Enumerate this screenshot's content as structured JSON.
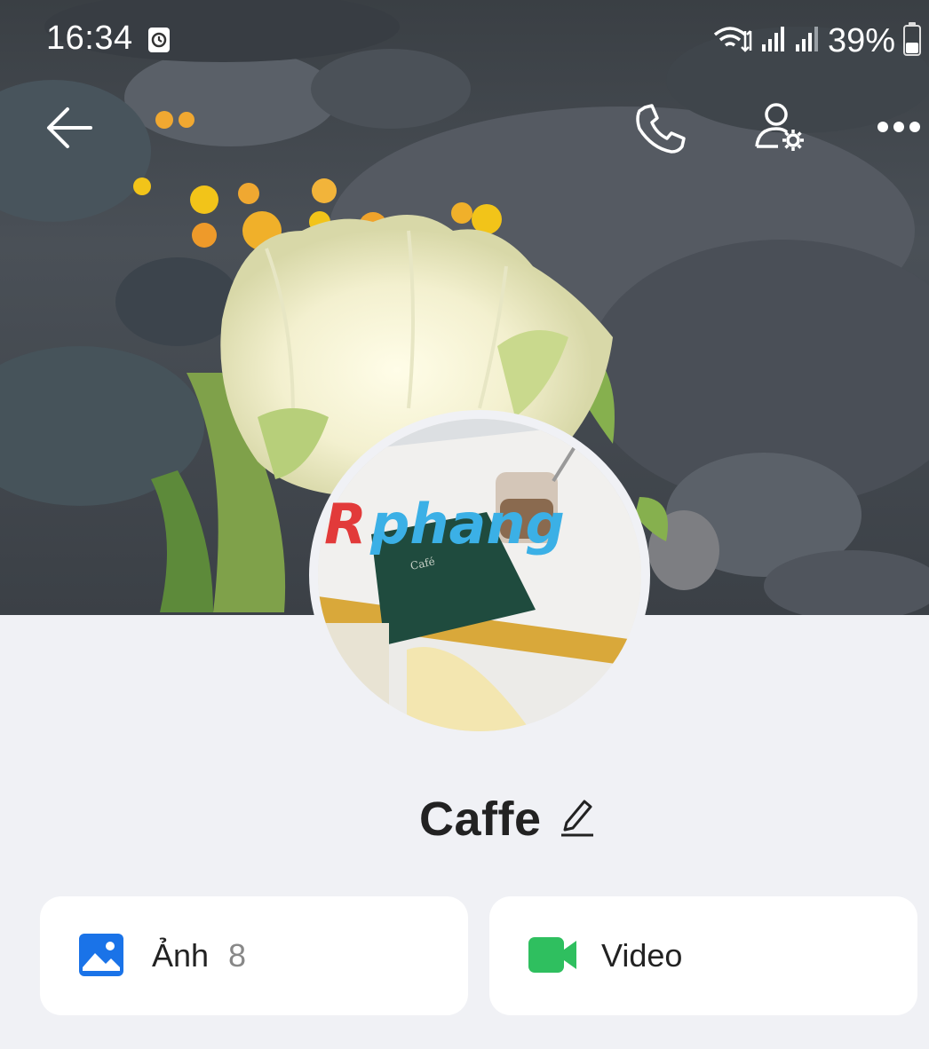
{
  "status_bar": {
    "time": "16:34",
    "battery": "39%",
    "icons": [
      "alarm-icon",
      "wifi-icon",
      "signal-icon",
      "signal-icon",
      "battery-icon"
    ]
  },
  "header": {
    "icons": [
      "back-arrow-icon",
      "phone-icon",
      "user-settings-icon",
      "more-icon"
    ]
  },
  "profile": {
    "name": "Caffe",
    "edit_icon": "pencil-icon",
    "watermark": "Rphang"
  },
  "media": {
    "photos": {
      "label": "Ảnh",
      "count": "8",
      "icon": "image-icon",
      "color": "#1a73e8"
    },
    "video": {
      "label": "Video",
      "icon": "video-camera-icon",
      "color": "#2fbf5f"
    }
  },
  "colors": {
    "background": "#f0f1f5",
    "card": "#ffffff",
    "text": "#222222"
  }
}
